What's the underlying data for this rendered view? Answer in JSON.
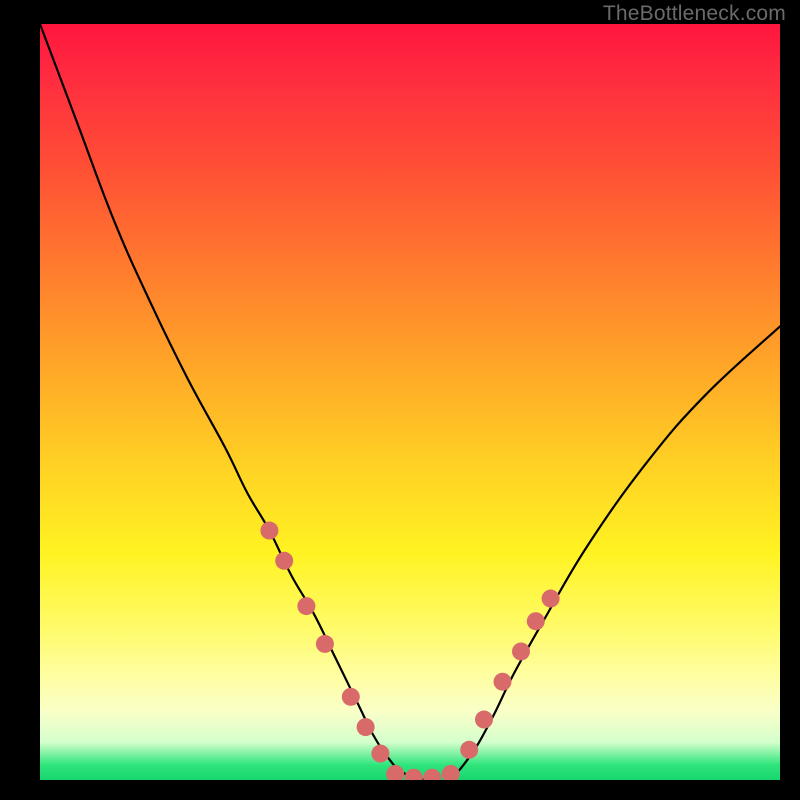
{
  "watermark": "TheBottleneck.com",
  "chart_data": {
    "type": "line",
    "title": "",
    "xlabel": "",
    "ylabel": "",
    "xlim": [
      0,
      100
    ],
    "ylim": [
      0,
      100
    ],
    "grid": false,
    "legend": "none",
    "series": [
      {
        "name": "bottleneck-curve",
        "x": [
          0,
          5,
          10,
          15,
          20,
          25,
          28,
          31,
          34,
          37,
          40,
          43,
          45,
          47,
          49,
          52,
          55,
          58,
          61,
          64,
          68,
          74,
          82,
          90,
          100
        ],
        "values": [
          100,
          87,
          74,
          63,
          53,
          44,
          38,
          33,
          27,
          22,
          16,
          10,
          6,
          3,
          1,
          0,
          0,
          3,
          8,
          14,
          21,
          31,
          42,
          51,
          60
        ]
      }
    ],
    "annotations": {
      "dot_clusters": [
        {
          "side": "left-arm",
          "x": [
            31.0,
            33.0,
            36.0,
            38.5,
            42.0,
            44.0,
            46.0
          ],
          "y": [
            33.0,
            29.0,
            23.0,
            18.0,
            11.0,
            7.0,
            3.5
          ]
        },
        {
          "side": "valley-floor",
          "x": [
            48.0,
            50.5,
            53.0,
            55.5
          ],
          "y": [
            0.8,
            0.3,
            0.3,
            0.8
          ]
        },
        {
          "side": "right-arm",
          "x": [
            58.0,
            60.0,
            62.5,
            65.0,
            67.0,
            69.0
          ],
          "y": [
            4.0,
            8.0,
            13.0,
            17.0,
            21.0,
            24.0
          ]
        }
      ]
    },
    "background_gradient": {
      "stops": [
        {
          "pos": 0.0,
          "color": "#ff153d"
        },
        {
          "pos": 0.2,
          "color": "#ff5234"
        },
        {
          "pos": 0.44,
          "color": "#ffa228"
        },
        {
          "pos": 0.7,
          "color": "#fff322"
        },
        {
          "pos": 0.86,
          "color": "#fffea0"
        },
        {
          "pos": 0.98,
          "color": "#2fe57b"
        }
      ]
    }
  }
}
